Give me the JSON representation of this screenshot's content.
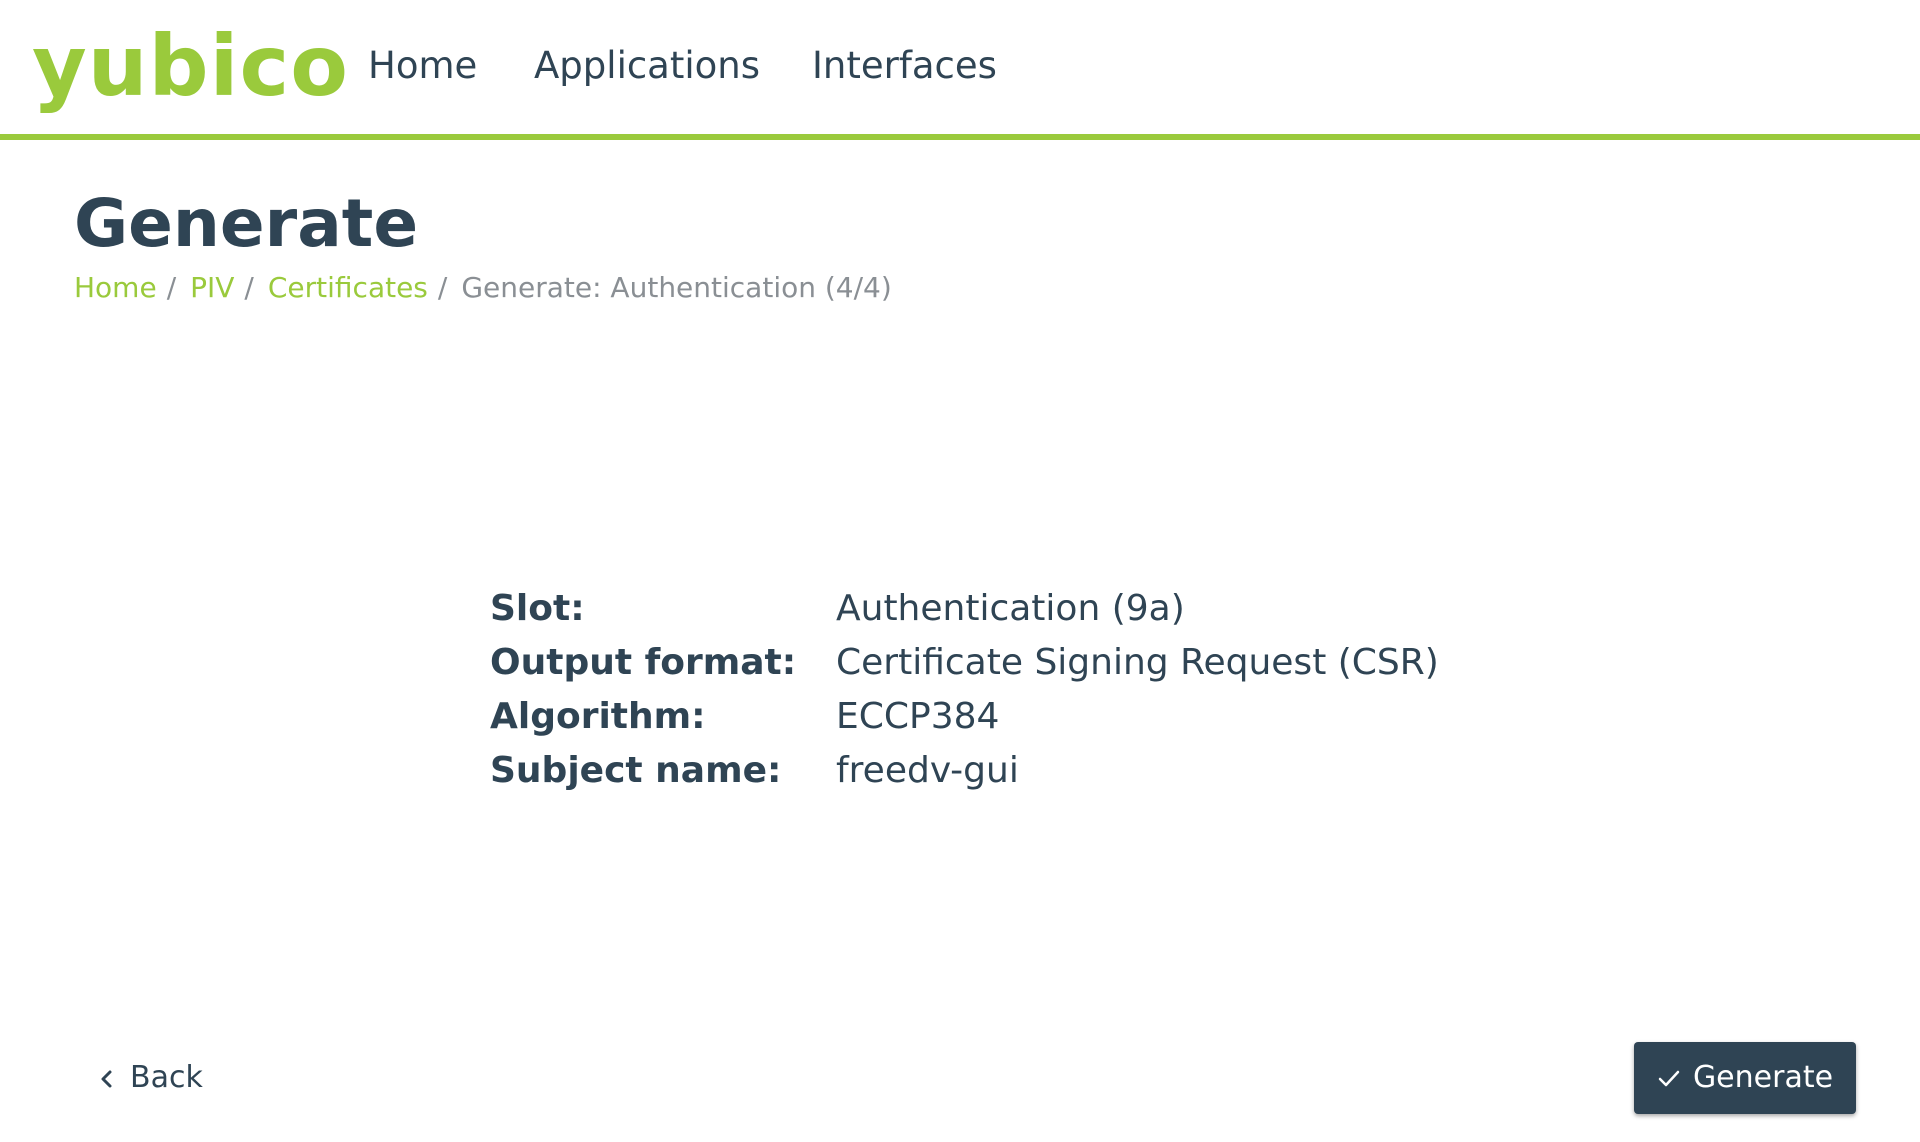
{
  "header": {
    "logo_text": "yubico",
    "nav": {
      "home": "Home",
      "applications": "Applications",
      "interfaces": "Interfaces"
    }
  },
  "page": {
    "title": "Generate",
    "breadcrumb": {
      "home": "Home",
      "piv": "PIV",
      "certificates": "Certificates",
      "current": "Generate: Authentication (4/4)",
      "separator": "/"
    }
  },
  "summary": {
    "rows": [
      {
        "label": "Slot:",
        "value": "Authentication (9a)"
      },
      {
        "label": "Output format:",
        "value": "Certificate Signing Request (CSR)"
      },
      {
        "label": "Algorithm:",
        "value": "ECCP384"
      },
      {
        "label": "Subject name:",
        "value": "freedv-gui"
      }
    ]
  },
  "footer": {
    "back_label": "Back",
    "back_icon": "chevron-left-icon",
    "generate_label": "Generate",
    "generate_icon": "check-icon"
  },
  "colors": {
    "brand_green": "#9aca3c",
    "text_dark": "#2f4454",
    "muted": "#8a8f94",
    "button_bg": "#2f4454"
  }
}
